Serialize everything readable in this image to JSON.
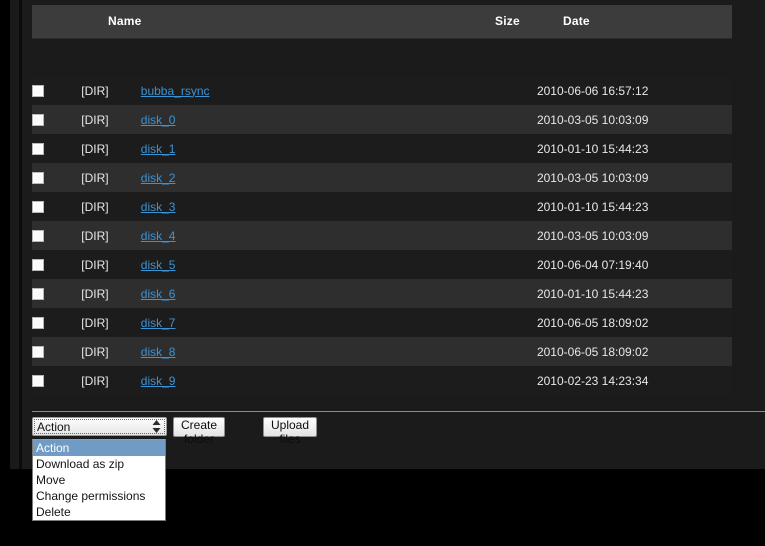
{
  "table": {
    "columns": {
      "check": "",
      "type": "",
      "name": "Name",
      "size": "Size",
      "date": "Date"
    },
    "rows": [
      {
        "type": "[DIR]",
        "name": "bubba_rsync",
        "size": "",
        "date": "2010-06-06 16:57:12"
      },
      {
        "type": "[DIR]",
        "name": "disk_0",
        "size": "",
        "date": "2010-03-05 10:03:09"
      },
      {
        "type": "[DIR]",
        "name": "disk_1",
        "size": "",
        "date": "2010-01-10 15:44:23"
      },
      {
        "type": "[DIR]",
        "name": "disk_2",
        "size": "",
        "date": "2010-03-05 10:03:09"
      },
      {
        "type": "[DIR]",
        "name": "disk_3",
        "size": "",
        "date": "2010-01-10 15:44:23"
      },
      {
        "type": "[DIR]",
        "name": "disk_4",
        "size": "",
        "date": "2010-03-05 10:03:09"
      },
      {
        "type": "[DIR]",
        "name": "disk_5",
        "size": "",
        "date": "2010-06-04 07:19:40"
      },
      {
        "type": "[DIR]",
        "name": "disk_6",
        "size": "",
        "date": "2010-01-10 15:44:23"
      },
      {
        "type": "[DIR]",
        "name": "disk_7",
        "size": "",
        "date": "2010-06-05 18:09:02"
      },
      {
        "type": "[DIR]",
        "name": "disk_8",
        "size": "",
        "date": "2010-06-05 18:09:02"
      },
      {
        "type": "[DIR]",
        "name": "disk_9",
        "size": "",
        "date": "2010-02-23 14:23:34"
      }
    ]
  },
  "toolbar": {
    "action_select": {
      "value": "Action",
      "expanded": true,
      "options": [
        "Action",
        "Download as zip",
        "Move",
        "Change permissions",
        "Delete"
      ],
      "selected_index": 0
    },
    "create_folder_label": "Create folder",
    "upload_files_label": "Upload files"
  },
  "colors": {
    "panel_background": "#1b1b1b",
    "header_background": "#3c3c3c",
    "row_odd": "#1c1c1c",
    "row_even": "#2e2e2e",
    "link": "#3c93d4",
    "dropdown_highlight": "#6f9bc4",
    "divider": "#8c8c8c"
  }
}
